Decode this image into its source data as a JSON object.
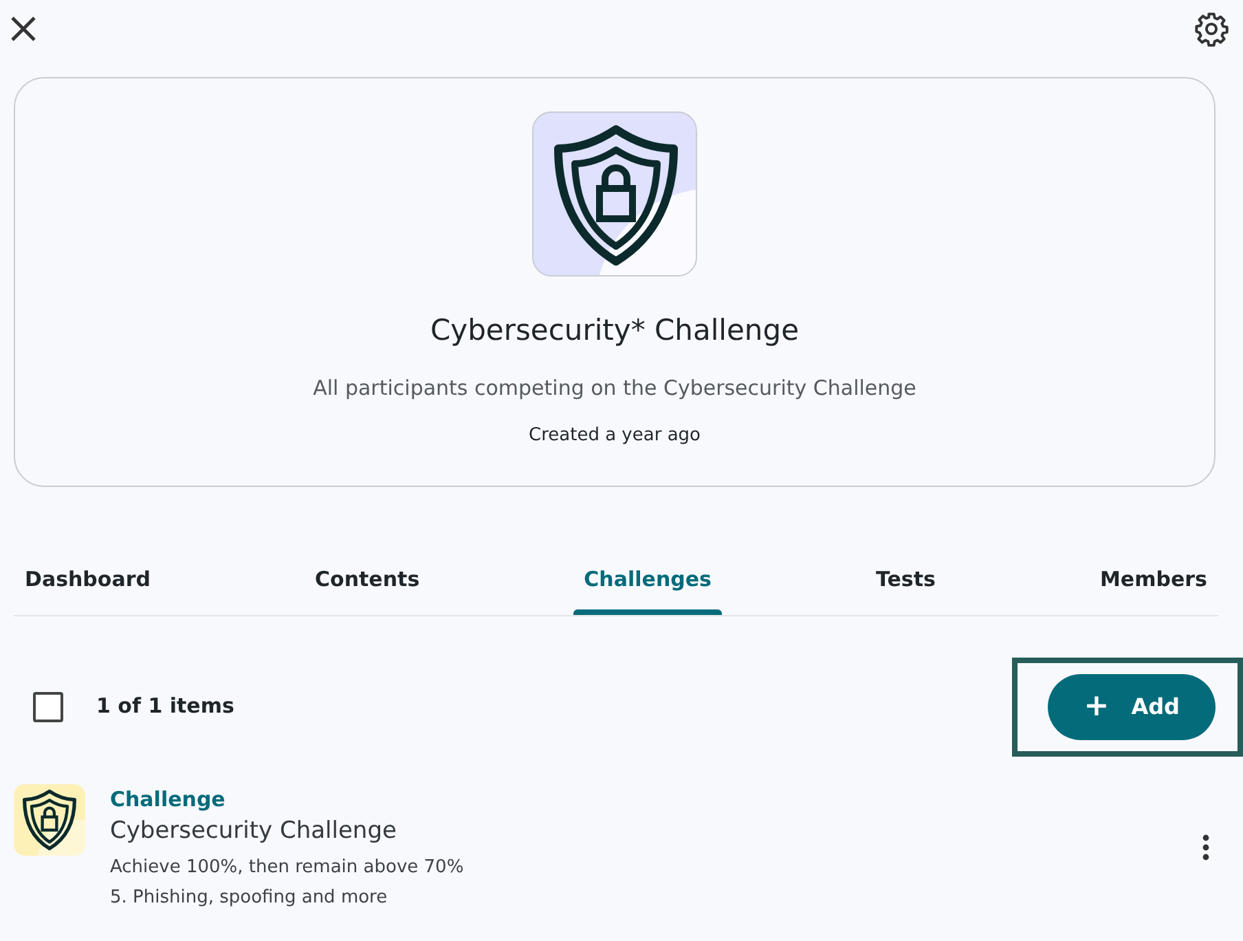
{
  "group": {
    "title": "Cybersecurity* Challenge",
    "description": "All participants competing on the Cybersecurity Challenge",
    "created": "Created a year ago"
  },
  "tabs": [
    {
      "label": "Dashboard",
      "selected": false
    },
    {
      "label": "Contents",
      "selected": false
    },
    {
      "label": "Challenges",
      "selected": true
    },
    {
      "label": "Tests",
      "selected": false
    },
    {
      "label": "Members",
      "selected": false
    }
  ],
  "toolbar": {
    "select_all_checked": false,
    "count": "1 of 1 items",
    "add_button": {
      "label": "Add",
      "icon": "+",
      "highlighted": true
    }
  },
  "items": [
    {
      "type": "Challenge",
      "title": "Cybersecurity Challenge",
      "lines": [
        "Achieve 100%, then remain above 70%",
        "5. Phishing, spoofing and more"
      ]
    }
  ]
}
